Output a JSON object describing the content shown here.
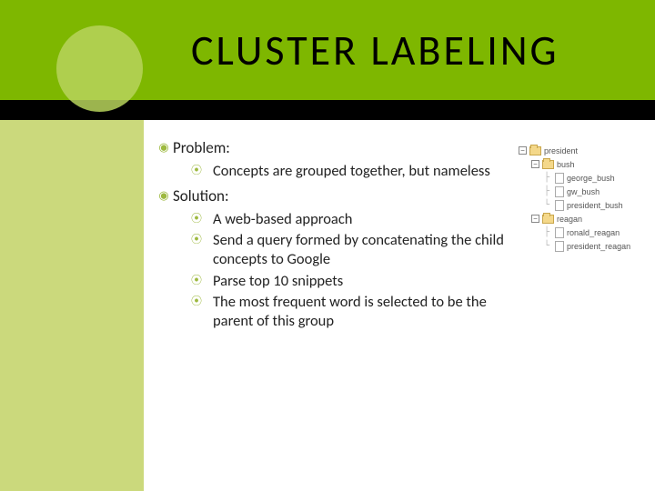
{
  "title": "CLUSTER LABELING",
  "content": {
    "sections": [
      {
        "label": "Problem:",
        "items": [
          "Concepts are grouped together, but nameless"
        ]
      },
      {
        "label": "Solution:",
        "items": [
          "A web-based approach",
          "Send a query formed by concatenating the child concepts to Google",
          "Parse top 10 snippets",
          "The most frequent word is selected to be the parent of this group"
        ]
      }
    ]
  },
  "tree": {
    "root": "president",
    "children": [
      {
        "name": "bush",
        "files": [
          "george_bush",
          "gw_bush",
          "president_bush"
        ]
      },
      {
        "name": "reagan",
        "files": [
          "ronald_reagan",
          "president_reagan"
        ]
      }
    ]
  },
  "chart_data": {
    "type": "table",
    "title": "Concept tree",
    "rows": [
      [
        "president",
        ""
      ],
      [
        "president",
        "bush"
      ],
      [
        "president/bush",
        "george_bush"
      ],
      [
        "president/bush",
        "gw_bush"
      ],
      [
        "president/bush",
        "president_bush"
      ],
      [
        "president",
        "reagan"
      ],
      [
        "president/reagan",
        "ronald_reagan"
      ],
      [
        "president/reagan",
        "president_reagan"
      ]
    ]
  }
}
